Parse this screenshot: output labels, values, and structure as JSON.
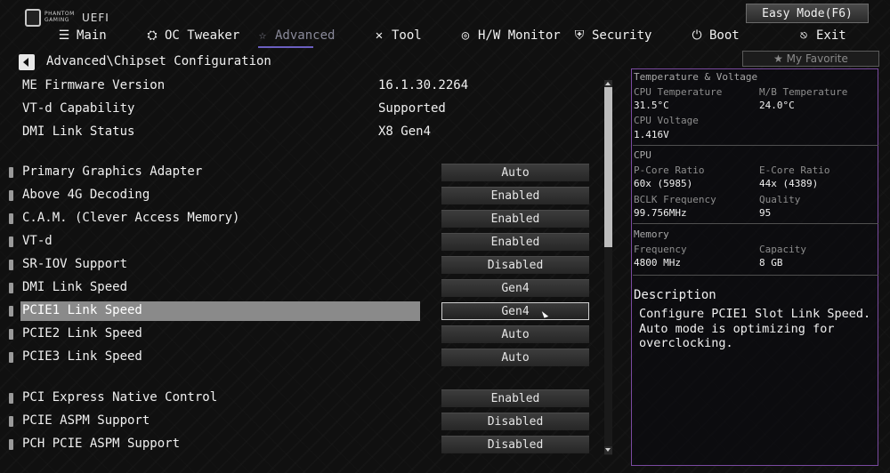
{
  "brand": {
    "line1": "PHANTOM",
    "line2": "GAMING",
    "uefi": "UEFI"
  },
  "easy_mode_label": "Easy Mode(F6)",
  "tabs": [
    {
      "label": "Main",
      "icon": "list-icon"
    },
    {
      "label": "OC Tweaker",
      "icon": "rocket-icon"
    },
    {
      "label": "Advanced",
      "icon": "star-icon"
    },
    {
      "label": "Tool",
      "icon": "tools-icon"
    },
    {
      "label": "H/W Monitor",
      "icon": "monitor-icon"
    },
    {
      "label": "Security",
      "icon": "shield-icon"
    },
    {
      "label": "Boot",
      "icon": "power-icon"
    },
    {
      "label": "Exit",
      "icon": "exit-icon"
    }
  ],
  "active_tab": "Advanced",
  "breadcrumb": "Advanced\\Chipset Configuration",
  "my_favorite_label": "My Favorite",
  "info_rows": [
    {
      "label": "ME Firmware Version",
      "value": "16.1.30.2264"
    },
    {
      "label": "VT-d Capability",
      "value": "Supported"
    },
    {
      "label": "DMI Link Status",
      "value": "X8  Gen4"
    }
  ],
  "settings": [
    {
      "label": "Primary Graphics Adapter",
      "value": "Auto"
    },
    {
      "label": "Above 4G Decoding",
      "value": "Enabled"
    },
    {
      "label": "C.A.M. (Clever Access Memory)",
      "value": "Enabled"
    },
    {
      "label": "VT-d",
      "value": "Enabled"
    },
    {
      "label": "SR-IOV Support",
      "value": "Disabled"
    },
    {
      "label": "DMI Link Speed",
      "value": "Gen4"
    },
    {
      "label": "PCIE1 Link Speed",
      "value": "Gen4",
      "selected": true
    },
    {
      "label": "PCIE2 Link Speed",
      "value": "Auto"
    },
    {
      "label": "PCIE3 Link Speed",
      "value": "Auto"
    },
    {
      "label": "PCI Express Native Control",
      "value": "Enabled"
    },
    {
      "label": "PCIE ASPM Support",
      "value": "Disabled"
    },
    {
      "label": "PCH PCIE ASPM Support",
      "value": "Disabled"
    }
  ],
  "panel": {
    "temp_voltage_title": "Temperature & Voltage",
    "cpu_temp_label": "CPU Temperature",
    "cpu_temp_value": "31.5°C",
    "mb_temp_label": "M/B Temperature",
    "mb_temp_value": "24.0°C",
    "cpu_voltage_label": "CPU Voltage",
    "cpu_voltage_value": "1.416V",
    "cpu_title": "CPU",
    "pcore_label": "P-Core Ratio",
    "pcore_value": "60x (5985)",
    "ecore_label": "E-Core Ratio",
    "ecore_value": "44x (4389)",
    "bclk_label": "BCLK Frequency",
    "bclk_value": "99.756MHz",
    "quality_label": "Quality",
    "quality_value": "95",
    "memory_title": "Memory",
    "freq_label": "Frequency",
    "freq_value": "4800 MHz",
    "cap_label": "Capacity",
    "cap_value": "8 GB"
  },
  "description": {
    "title": "Description",
    "text": "Configure PCIE1 Slot Link Speed.\nAuto mode is optimizing for\noverclocking."
  },
  "colors": {
    "accent": "#6b5fc0",
    "panel_border": "#7a4aa0",
    "selected_row": "#8a8a8a"
  }
}
